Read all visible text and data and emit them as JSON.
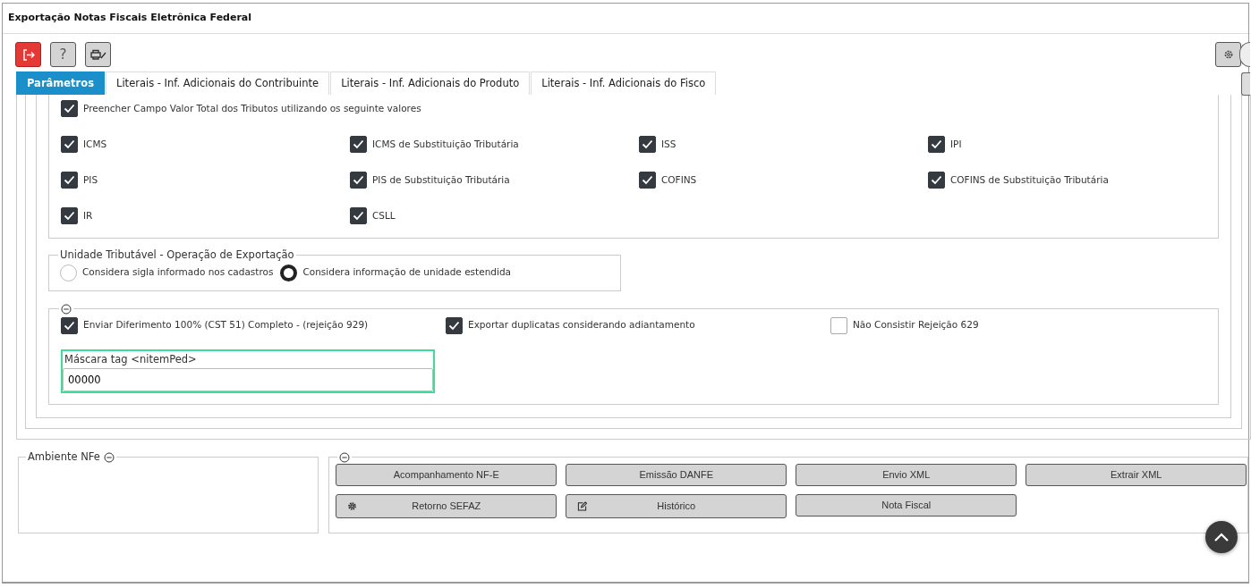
{
  "window": {
    "title": "Exportação Notas Fiscais Eletrônica Federal"
  },
  "toolbar": {
    "help_label": "?"
  },
  "tabs": [
    {
      "label": "Parâmetros",
      "selected": true
    },
    {
      "label": "Literais - Inf. Adicionais do Contribuinte",
      "selected": false
    },
    {
      "label": "Literais - Inf. Adicionais do Produto",
      "selected": false
    },
    {
      "label": "Literais - Inf. Adicionais do Fisco",
      "selected": false
    }
  ],
  "tax_totals": {
    "label": "Preencher Campo Valor Total dos Tributos utilizando os seguinte valores",
    "checked": true,
    "items": [
      {
        "label": "ICMS",
        "checked": true
      },
      {
        "label": "ICMS de Substituição Tributária",
        "checked": true
      },
      {
        "label": "ISS",
        "checked": true
      },
      {
        "label": "IPI",
        "checked": true
      },
      {
        "label": "PIS",
        "checked": true
      },
      {
        "label": "PIS de Substituição Tributária",
        "checked": true
      },
      {
        "label": "COFINS",
        "checked": true
      },
      {
        "label": "COFINS de Substituição Tributária",
        "checked": true
      },
      {
        "label": "IR",
        "checked": true
      },
      {
        "label": "CSLL",
        "checked": true
      }
    ]
  },
  "unit_group": {
    "legend": "Unidade Tributável - Operação de Exportação",
    "options": [
      {
        "label": "Considera sigla informado nos cadastros",
        "selected": false
      },
      {
        "label": "Considera informação de unidade estendida",
        "selected": true
      }
    ]
  },
  "options_section": {
    "checkboxes": [
      {
        "label": "Enviar Diferimento 100% (CST 51) Completo - (rejeição 929)",
        "checked": true
      },
      {
        "label": "Exportar duplicatas considerando adiantamento",
        "checked": true
      },
      {
        "label": "Não Consistir Rejeição 629",
        "checked": false
      }
    ],
    "mask_field": {
      "label": "Máscara tag <nitemPed>",
      "value": "00000"
    }
  },
  "ambiente": {
    "legend": "Ambiente NFe"
  },
  "actions": [
    {
      "label": "Acompanhamento NF-E",
      "kind": "plain"
    },
    {
      "label": "Emissão DANFE",
      "kind": "plain"
    },
    {
      "label": "Envio XML",
      "kind": "plain"
    },
    {
      "label": "Extrair XML",
      "kind": "plain"
    },
    {
      "label": "Retorno SEFAZ",
      "kind": "gear"
    },
    {
      "label": "Histórico",
      "kind": "edit"
    },
    {
      "label": "Nota Fiscal",
      "kind": "plain"
    }
  ]
}
